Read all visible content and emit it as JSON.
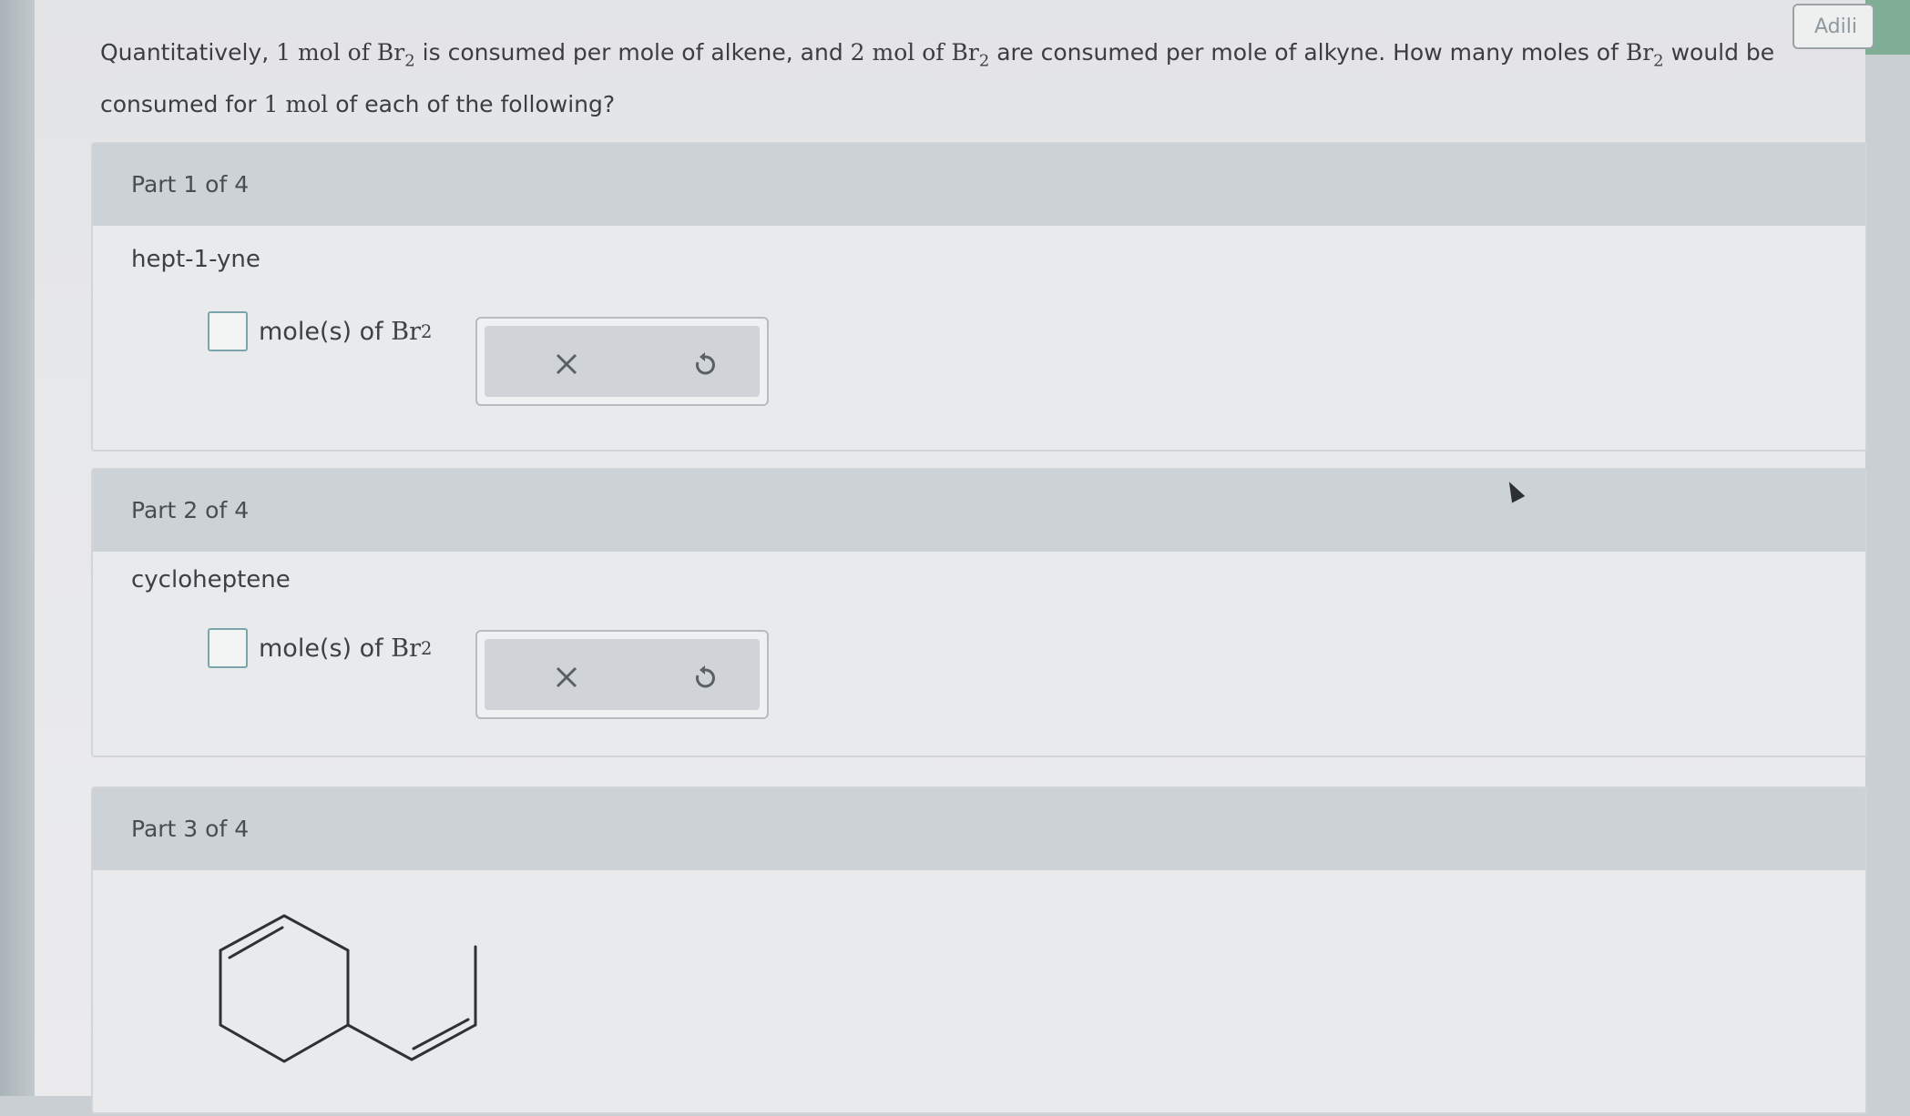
{
  "header": {
    "account_label": "Adili"
  },
  "question": {
    "seg1": "Quantitatively, ",
    "qty1": "1 mol of Br",
    "sub1": "2",
    "seg2": " is consumed per mole of alkene, and ",
    "qty2": "2 mol of Br",
    "sub2": "2",
    "seg3": " are consumed per mole of alkyne. How many moles of ",
    "qty3": "Br",
    "sub3": "2",
    "seg4": " would be consumed for ",
    "qty4": "1 mol",
    "seg5": " of each of the following?"
  },
  "parts": [
    {
      "header": "Part 1 of 4",
      "compound": "hept-1-yne",
      "unit_label": "mole(s) of ",
      "unit_formula": "Br",
      "unit_sub": "2",
      "answer_value": ""
    },
    {
      "header": "Part 2 of 4",
      "compound": "cycloheptene",
      "unit_label": "mole(s) of ",
      "unit_formula": "Br",
      "unit_sub": "2",
      "answer_value": ""
    },
    {
      "header": "Part 3 of 4"
    }
  ],
  "icons": {
    "clear": "x-icon",
    "undo": "undo-icon",
    "structure": "cyclohexene-vinyl-structure"
  }
}
